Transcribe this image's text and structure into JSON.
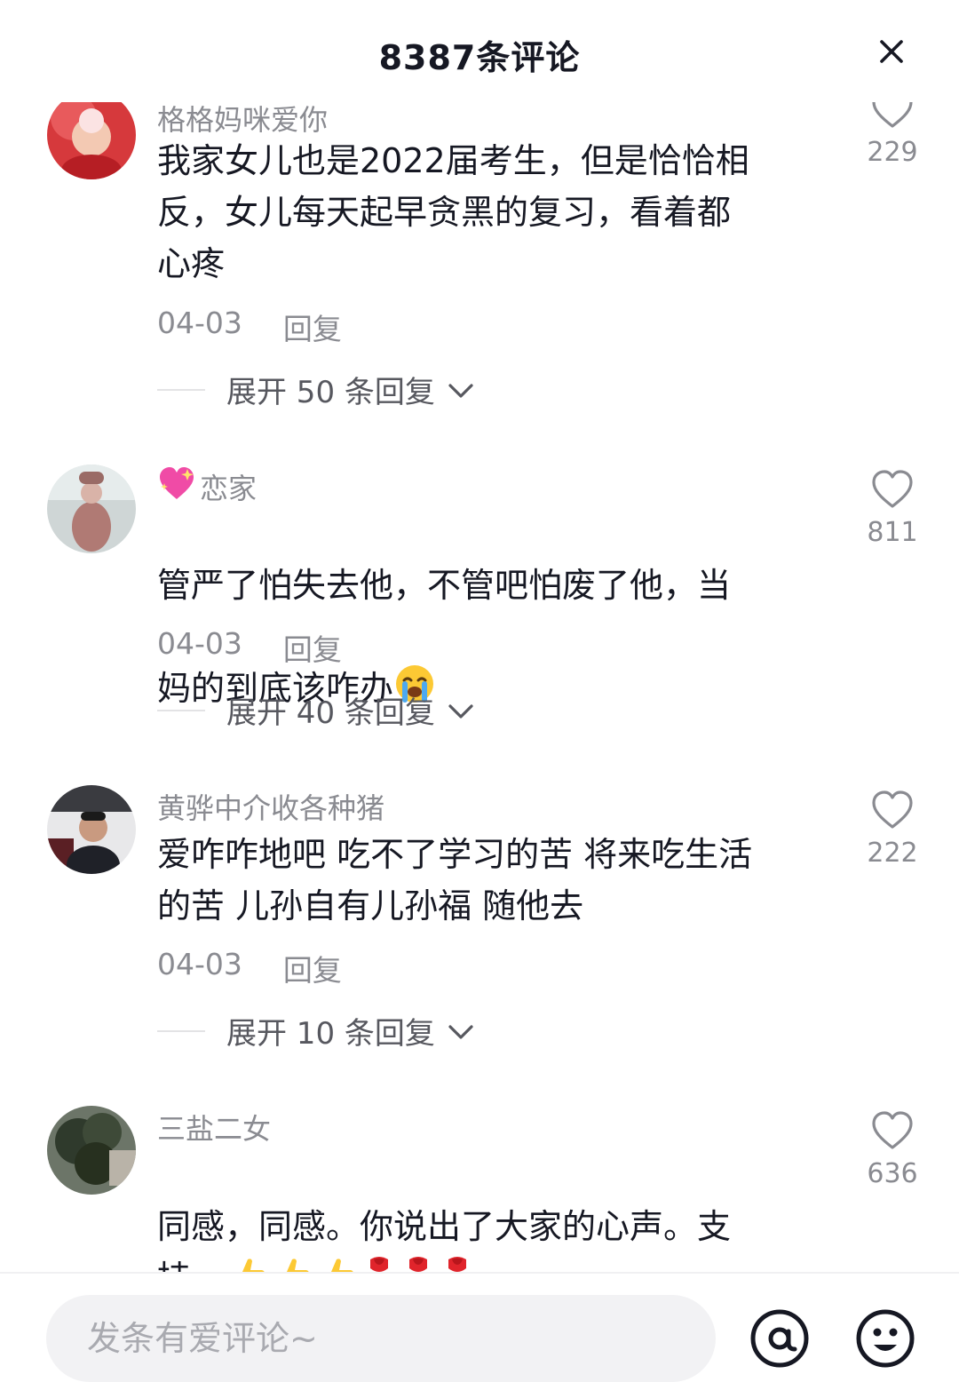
{
  "header": {
    "title": "8387条评论"
  },
  "comments": [
    {
      "username": "格格妈咪爱你",
      "text": "我家女儿也是2022届考生，但是恰恰相\n反，女儿每天起早贪黑的复习，看着都\n心疼",
      "date": "04-03",
      "reply_label": "回复",
      "expand_label": "展开 50 条回复",
      "likes": "229"
    },
    {
      "username_prefix_icon": "sparkling-heart-emoji",
      "username": "恋家",
      "text": "管严了怕失去他，不管吧怕废了他，当\n妈的到底该咋办",
      "text_suffix_icon": "crying-face-emoji",
      "date": "04-03",
      "reply_label": "回复",
      "expand_label": "展开 40 条回复",
      "likes": "811"
    },
    {
      "username": "黄骅中介收各种猪",
      "text": "爱咋咋地吧 吃不了学习的苦 将来吃生活\n的苦 儿孙自有儿孙福 随他去",
      "date": "04-03",
      "reply_label": "回复",
      "expand_label": "展开 10 条回复",
      "likes": "222"
    },
    {
      "username": "三盐二女",
      "text": "同感，同感。你说出了大家的心声。支\n持。",
      "text_suffix_icons": [
        "thumbs-up-emoji",
        "thumbs-up-emoji",
        "thumbs-up-emoji",
        "rose-emoji",
        "rose-emoji",
        "rose-emoji"
      ],
      "likes": "636"
    }
  ],
  "footer": {
    "input_placeholder": "发条有爱评论~",
    "icons": [
      "at-mention-icon",
      "smiley-emoji-icon"
    ]
  }
}
